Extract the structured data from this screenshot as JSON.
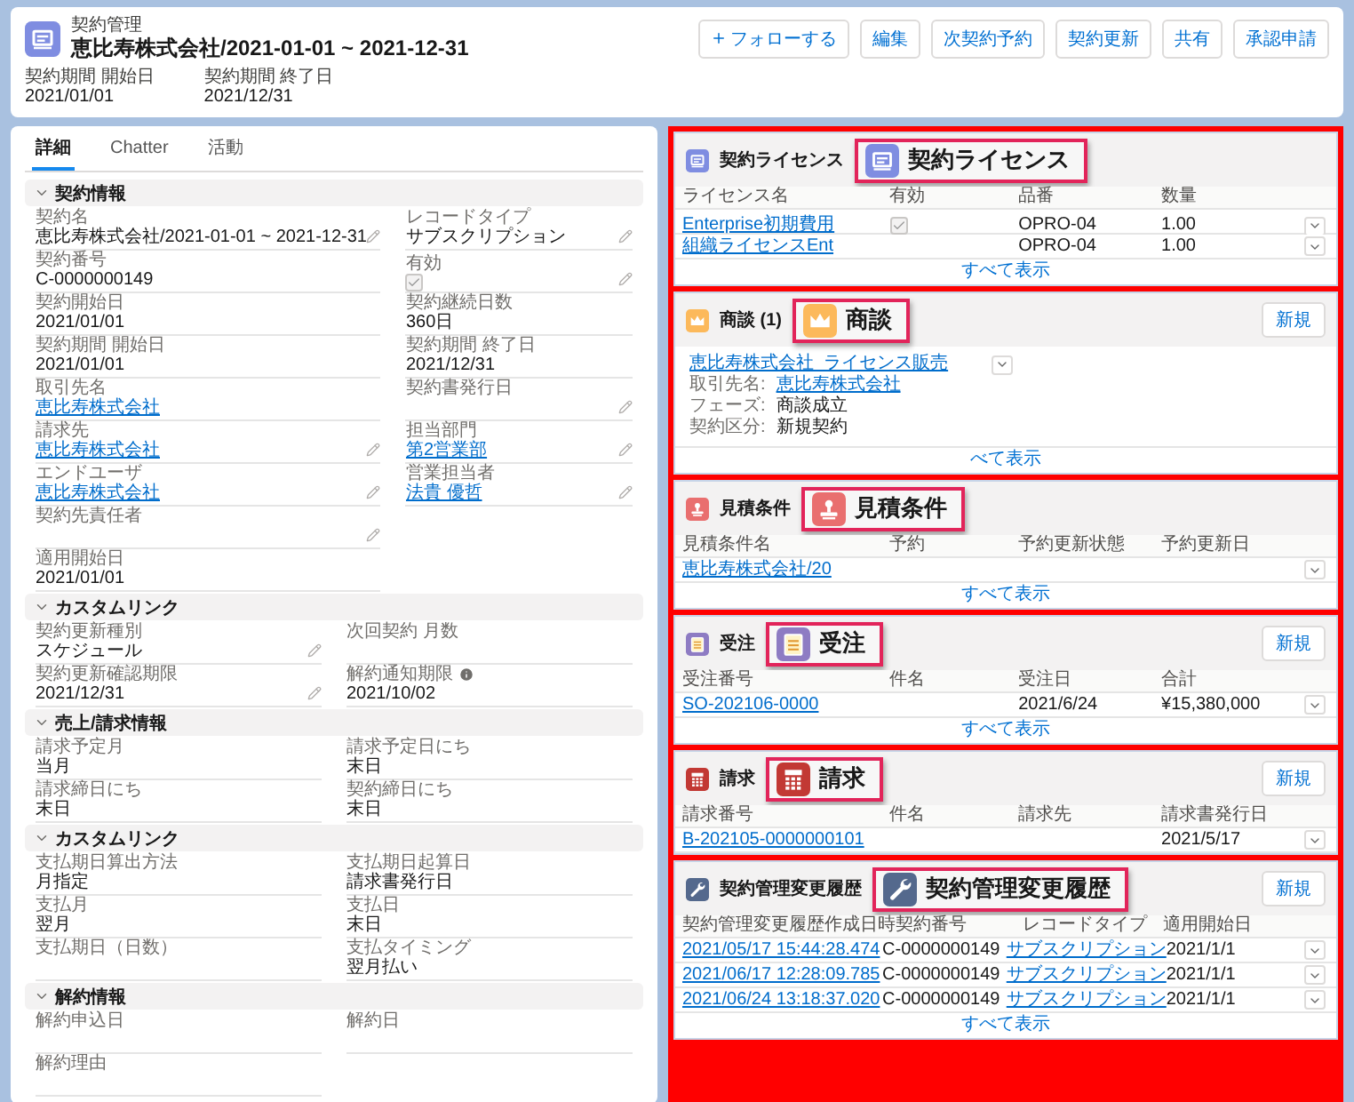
{
  "header": {
    "object": "契約管理",
    "title": "恵比寿株式会社/2021-01-01 ~ 2021-12-31",
    "buttons": [
      {
        "label": "フォローする",
        "plus": true
      },
      {
        "label": "編集",
        "plus": false
      },
      {
        "label": "次契約予約",
        "plus": false
      },
      {
        "label": "契約更新",
        "plus": false
      },
      {
        "label": "共有",
        "plus": false
      },
      {
        "label": "承認申請",
        "plus": false
      }
    ],
    "fields": [
      {
        "label": "契約期間 開始日",
        "value": "2021/01/01"
      },
      {
        "label": "契約期間 終了日",
        "value": "2021/12/31"
      }
    ]
  },
  "tabs": [
    {
      "label": "詳細",
      "selected": true
    },
    {
      "label": "Chatter",
      "selected": false
    },
    {
      "label": "活動",
      "selected": false
    }
  ],
  "sections": [
    {
      "title": "契約情報",
      "rows": [
        {
          "left": {
            "label": "契約名",
            "value": "恵比寿株式会社/2021-01-01 ~ 2021-12-31",
            "kind": "text",
            "editable": true
          },
          "right": {
            "label": "レコードタイプ",
            "value": "サブスクリプション",
            "kind": "text",
            "editable": true
          }
        },
        {
          "left": {
            "label": "契約番号",
            "value": "C-0000000149",
            "kind": "text",
            "editable": false
          },
          "right": {
            "label": "有効",
            "kind": "check",
            "checked": true,
            "editable": true
          }
        },
        {
          "left": {
            "label": "契約開始日",
            "value": "2021/01/01",
            "kind": "text",
            "editable": false
          },
          "right": {
            "label": "契約継続日数",
            "value": "360日",
            "kind": "text",
            "editable": false
          }
        },
        {
          "left": {
            "label": "契約期間 開始日",
            "value": "2021/01/01",
            "kind": "text",
            "editable": false
          },
          "right": {
            "label": "契約期間 終了日",
            "value": "2021/12/31",
            "kind": "text",
            "editable": false
          }
        },
        {
          "left": {
            "label": "取引先名",
            "value": "恵比寿株式会社",
            "kind": "link",
            "editable": false
          },
          "right": {
            "label": "契約書発行日",
            "kind": "text",
            "editable": true
          }
        },
        {
          "left": {
            "label": "請求先",
            "value": "恵比寿株式会社",
            "kind": "link",
            "editable": true
          },
          "right": {
            "label": "担当部門",
            "value": "第2営業部",
            "kind": "link",
            "editable": true
          }
        },
        {
          "left": {
            "label": "エンドユーザ",
            "value": "恵比寿株式会社",
            "kind": "link",
            "editable": true
          },
          "right": {
            "label": "営業担当者",
            "value": "法貴 優哲",
            "kind": "link",
            "editable": true
          }
        },
        {
          "left": {
            "label": "契約先責任者",
            "kind": "text",
            "editable": true
          }
        },
        {
          "left": {
            "label": "適用開始日",
            "value": "2021/01/01",
            "kind": "text",
            "editable": false
          }
        }
      ]
    },
    {
      "title": "カスタムリンク",
      "rows": [
        {
          "left": {
            "label": "契約更新種別",
            "value": "スケジュール",
            "kind": "text",
            "editable": true
          },
          "right": {
            "label": "次回契約 月数",
            "kind": "text",
            "editable": false
          }
        },
        {
          "left": {
            "label": "契約更新確認期限",
            "value": "2021/12/31",
            "kind": "text",
            "editable": true
          },
          "right": {
            "label": "解約通知期限",
            "value": "2021/10/02",
            "kind": "text",
            "editable": false,
            "info": true
          }
        }
      ]
    },
    {
      "title": "売上/請求情報",
      "rows": [
        {
          "left": {
            "label": "請求予定月",
            "value": "当月",
            "kind": "text",
            "editable": false
          },
          "right": {
            "label": "請求予定日にち",
            "value": "末日",
            "kind": "text",
            "editable": false
          }
        },
        {
          "left": {
            "label": "請求締日にち",
            "value": "末日",
            "kind": "text",
            "editable": false
          },
          "right": {
            "label": "契約締日にち",
            "value": "末日",
            "kind": "text",
            "editable": false
          }
        }
      ]
    },
    {
      "title": "カスタムリンク",
      "rows": [
        {
          "left": {
            "label": "支払期日算出方法",
            "value": "月指定",
            "kind": "text",
            "editable": false
          },
          "right": {
            "label": "支払期日起算日",
            "value": "請求書発行日",
            "kind": "text",
            "editable": false
          }
        },
        {
          "left": {
            "label": "支払月",
            "value": "翌月",
            "kind": "text",
            "editable": false
          },
          "right": {
            "label": "支払日",
            "value": "末日",
            "kind": "text",
            "editable": false
          }
        },
        {
          "left": {
            "label": "支払期日（日数）",
            "kind": "text",
            "editable": false
          },
          "right": {
            "label": "支払タイミング",
            "value": "翌月払い",
            "kind": "text",
            "editable": false
          }
        }
      ]
    },
    {
      "title": "解約情報",
      "rows": [
        {
          "left": {
            "label": "解約申込日",
            "kind": "text",
            "editable": false
          },
          "right": {
            "label": "解約日",
            "kind": "text",
            "editable": false
          }
        },
        {
          "left": {
            "label": "解約理由",
            "kind": "text",
            "editable": false
          }
        }
      ]
    }
  ],
  "cards": [
    {
      "title": "契約ライセンス",
      "color": "#7f8de1",
      "callout": "契約ライセンス",
      "new_button": false,
      "kind": "table",
      "columns": [
        "ライセンス名",
        "有効",
        "品番",
        "数量"
      ],
      "rows": [
        {
          "cells": [
            {
              "kind": "link",
              "text": "Enterprise初期費用"
            },
            {
              "kind": "check",
              "checked": true
            },
            {
              "kind": "text",
              "text": "OPRO-04"
            },
            {
              "kind": "text",
              "text": "1.00"
            }
          ]
        },
        {
          "cells": [
            {
              "kind": "link",
              "text": "組織ライセンスEnt"
            },
            {
              "kind": "none"
            },
            {
              "kind": "text",
              "text": "OPRO-04"
            },
            {
              "kind": "text",
              "text": "1.00"
            }
          ]
        }
      ],
      "footer": "すべて表示"
    },
    {
      "title": "商談 (1)",
      "color": "#fcb95b",
      "callout": "商談",
      "new_button": "新規",
      "kind": "record",
      "record": {
        "name": "恵比寿株式会社_ライセンス販売",
        "fields": [
          {
            "label": "取引先名:",
            "value": "恵比寿株式会社",
            "link": true
          },
          {
            "label": "フェーズ:",
            "value": "商談成立",
            "link": false
          },
          {
            "label": "契約区分:",
            "value": "新規契約",
            "link": false
          }
        ]
      },
      "footer": "べて表示"
    },
    {
      "title": "見積条件",
      "color": "#e96f6f",
      "callout": "見積条件",
      "new_button": false,
      "kind": "table",
      "columns": [
        "見積条件名",
        "予約",
        "予約更新状態",
        "予約更新日"
      ],
      "rows": [
        {
          "cells": [
            {
              "kind": "link",
              "text": "恵比寿株式会社/20"
            },
            {
              "kind": "none"
            },
            {
              "kind": "none"
            },
            {
              "kind": "none"
            }
          ]
        }
      ],
      "footer": "すべて表示"
    },
    {
      "title": "受注",
      "color": "#8e7cc3",
      "callout": "受注",
      "new_button": "新規",
      "kind": "table",
      "columns": [
        "受注番号",
        "件名",
        "受注日",
        "合計"
      ],
      "rows": [
        {
          "cells": [
            {
              "kind": "link",
              "text": "SO-202106-0000"
            },
            {
              "kind": "none"
            },
            {
              "kind": "text",
              "text": "2021/6/24"
            },
            {
              "kind": "text",
              "text": "¥15,380,000"
            }
          ]
        }
      ],
      "footer": "すべて表示"
    },
    {
      "title": "請求",
      "color": "#c23934",
      "callout": "請求",
      "new_button": "新規",
      "kind": "table",
      "columns": [
        "請求番号",
        "件名",
        "請求先",
        "請求書発行日"
      ],
      "rows": [
        {
          "cells": [
            {
              "kind": "link",
              "text": "B-202105-0000000101"
            },
            {
              "kind": "none"
            },
            {
              "kind": "none"
            },
            {
              "kind": "text",
              "text": "2021/5/17"
            }
          ]
        }
      ]
    },
    {
      "title": "契約管理変更履歴",
      "color": "#54698d",
      "callout": "契約管理変更履歴",
      "new_button": "新規",
      "kind": "table",
      "columns": [
        "契約管理変更履歴作成日時",
        "契約番号",
        "レコードタイプ",
        "適用開始日"
      ],
      "rows": [
        {
          "cells": [
            {
              "kind": "link",
              "text": "2021/05/17 15:44:28.474"
            },
            {
              "kind": "text",
              "text": "C-0000000149"
            },
            {
              "kind": "link",
              "text": "サブスクリプション"
            },
            {
              "kind": "text",
              "text": "2021/1/1"
            }
          ]
        },
        {
          "cells": [
            {
              "kind": "link",
              "text": "2021/06/17 12:28:09.785"
            },
            {
              "kind": "text",
              "text": "C-0000000149"
            },
            {
              "kind": "link",
              "text": "サブスクリプション"
            },
            {
              "kind": "text",
              "text": "2021/1/1"
            }
          ]
        },
        {
          "cells": [
            {
              "kind": "link",
              "text": "2021/06/24 13:18:37.020"
            },
            {
              "kind": "text",
              "text": "C-0000000149"
            },
            {
              "kind": "link",
              "text": "サブスクリプション"
            },
            {
              "kind": "text",
              "text": "2021/1/1"
            }
          ]
        }
      ],
      "footer": "すべて表示"
    }
  ]
}
